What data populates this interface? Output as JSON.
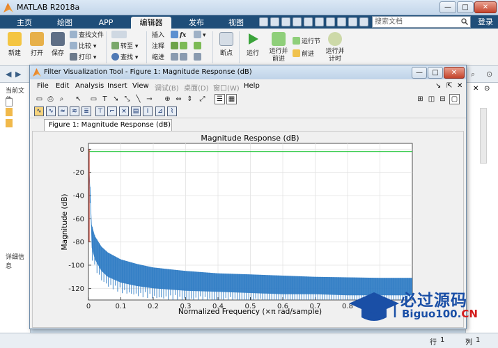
{
  "app": {
    "title": "MATLAB R2018a",
    "tabs": [
      "主页",
      "绘图",
      "APP",
      "编辑器",
      "发布",
      "视图"
    ],
    "active_tab": "编辑器",
    "search_placeholder": "搜索文档",
    "login": "登录"
  },
  "ribbon": {
    "new": "新建",
    "open": "打开",
    "save": "保存",
    "find_files": "查找文件",
    "compare": "比较",
    "print": "打印",
    "goto": "转至",
    "find": "查找",
    "insert": "插入",
    "comment": "注释",
    "indent": "缩进",
    "breakpoints": "断点",
    "run": "运行",
    "run_advance": "运行并前进",
    "run_section": "运行节",
    "advance": "前进",
    "run_time": "运行并计时"
  },
  "left_panel": {
    "current_folder": "当前文件",
    "details": "详细信息"
  },
  "status": {
    "row_label": "行",
    "row_value": "1",
    "col_label": "列",
    "col_value": "1"
  },
  "fvtool": {
    "title": "Filter Visualization Tool - Figure 1: Magnitude Response (dB)",
    "menus": [
      {
        "label": "File",
        "enabled": true
      },
      {
        "label": "Edit",
        "enabled": true
      },
      {
        "label": "Analysis",
        "enabled": true
      },
      {
        "label": "Insert",
        "enabled": true
      },
      {
        "label": "View",
        "enabled": true
      },
      {
        "label": "调试(B)",
        "enabled": false
      },
      {
        "label": "桌面(D)",
        "enabled": false
      },
      {
        "label": "窗口(W)",
        "enabled": false
      },
      {
        "label": "Help",
        "enabled": true
      }
    ],
    "doc_tab": "Figure 1: Magnitude Response (dB)"
  },
  "chart_data": {
    "type": "line",
    "title": "Magnitude Response (dB)",
    "xlabel": "Normalized Frequency  (×π rad/sample)",
    "ylabel": "Magnitude (dB)",
    "xlim": [
      0,
      1
    ],
    "ylim": [
      -130,
      5
    ],
    "xticks": [
      "0",
      "0.1",
      "0.2",
      "0.3",
      "0.4",
      "0.5",
      "0.6",
      "0.7",
      "0.8",
      "0.9"
    ],
    "yticks": [
      "0",
      "-20",
      "-40",
      "-60",
      "-80",
      "-100",
      "-120"
    ],
    "grid": true,
    "series": [
      {
        "color": "#2f7cc4",
        "x": [
          0.0,
          0.01,
          0.02,
          0.04,
          0.06,
          0.1,
          0.15,
          0.2,
          0.3,
          0.4,
          0.5,
          0.6,
          0.7,
          0.8,
          0.9,
          1.0
        ],
        "y_upper": [
          0,
          -65,
          -75,
          -84,
          -89,
          -95,
          -99,
          -102,
          -105,
          -107,
          -108,
          -109,
          -110,
          -110.5,
          -111,
          -111
        ],
        "y_lower": [
          0,
          -85,
          -95,
          -105,
          -110,
          -115,
          -118,
          -120,
          -122,
          -123,
          -124,
          -125,
          -125,
          -126,
          -126,
          -126
        ]
      },
      {
        "color": "#22c63a",
        "x": [
          0,
          1
        ],
        "y": [
          -2,
          -2
        ]
      },
      {
        "color": "#c0392b",
        "x": [
          0,
          0
        ],
        "y": [
          0,
          -80
        ]
      }
    ]
  },
  "watermark": {
    "line1": "必过源码",
    "line2a": "Biguo100.",
    "line2b": "CN"
  }
}
